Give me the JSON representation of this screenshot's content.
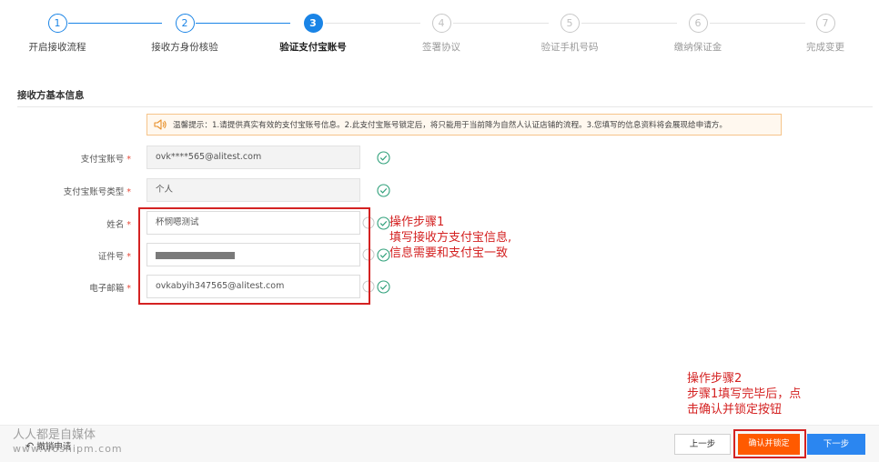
{
  "stepper": {
    "steps": [
      {
        "num": "1",
        "label": "开启接收流程"
      },
      {
        "num": "2",
        "label": "接收方身份核验"
      },
      {
        "num": "3",
        "label": "验证支付宝账号"
      },
      {
        "num": "4",
        "label": "签署协议"
      },
      {
        "num": "5",
        "label": "验证手机号码"
      },
      {
        "num": "6",
        "label": "缴纳保证金"
      },
      {
        "num": "7",
        "label": "完成变更"
      }
    ],
    "current_step": 3,
    "colors": {
      "active": "#1a84e6",
      "future": "#c8c8c8"
    }
  },
  "section": {
    "title": "接收方基本信息"
  },
  "notice": {
    "icon": "speaker-icon",
    "text": "温馨提示：1.请提供真实有效的支付宝账号信息。2.此支付宝账号锁定后，将只能用于当前降为自然人认证店铺的流程。3.您填写的信息资料将会展现给申请方。"
  },
  "form": {
    "required_mark": "*",
    "alipay_account": {
      "label": "支付宝账号",
      "value": "ovk****565@alitest.com"
    },
    "account_type": {
      "label": "支付宝账号类型",
      "value": "个人"
    },
    "name": {
      "label": "姓名",
      "value": "杯悯嗯测试"
    },
    "id_number": {
      "label": "证件号",
      "value": ""
    },
    "email": {
      "label": "电子邮箱",
      "value": "ovkabyih347565@alitest.com"
    }
  },
  "annotations": {
    "step1": {
      "line1": "操作步骤1",
      "line2": "填写接收方支付宝信息,",
      "line3": "信息需要和支付宝一致"
    },
    "step2": {
      "line1": "操作步骤2",
      "line2": "步骤1填写完毕后，点",
      "line3": "击确认并锁定按钮"
    },
    "color": "#d42222"
  },
  "footer": {
    "revoke_label": "撤销申请",
    "prev_label": "上一步",
    "confirm_label": "确认并锁定",
    "next_label": "下一步",
    "colors": {
      "confirm": "#ff5a00",
      "next": "#2b86f0"
    }
  },
  "watermark": {
    "line1": "人人都是自媒体",
    "line2": "www.woshipm.com"
  }
}
